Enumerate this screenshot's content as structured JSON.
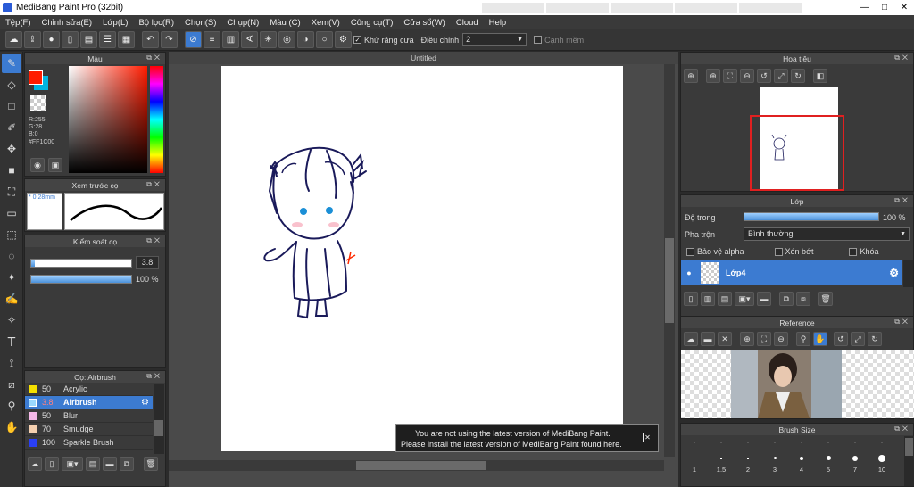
{
  "window": {
    "title": "MediBang Paint Pro (32bit)",
    "tabs": [
      "",
      "",
      "",
      "",
      "",
      ""
    ]
  },
  "menu": [
    "Tệp(F)",
    "Chỉnh sửa(E)",
    "Lớp(L)",
    "Bộ lọc(R)",
    "Chọn(S)",
    "Chụp(N)",
    "Màu (C)",
    "Xem(V)",
    "Công cụ(T)",
    "Cửa sổ(W)",
    "Cloud",
    "Help"
  ],
  "toolbar": {
    "antialias_label": "Khử răng cưa",
    "adjust_label": "Điều chỉnh",
    "adjust_value": "2",
    "canh_mem_label": "Cạnh mềm"
  },
  "color_panel": {
    "title": "Màu",
    "r": "R:255",
    "g": "G:28",
    "b": "B:0",
    "hex": "#FF1C00",
    "fg": "#ff1c00",
    "bg": "#00b4e0"
  },
  "brush_preview": {
    "title": "Xem trước cọ",
    "size": "* 0.28mm"
  },
  "brush_control": {
    "title": "Kiểm soát cọ",
    "size_value": "3.8",
    "opacity_value": "100 %",
    "opacity": 1.0
  },
  "brush_list": {
    "title": "Cọ: Airbrush",
    "items": [
      {
        "num": "50",
        "name": "Acrylic",
        "color": "#f5e000",
        "selected": false
      },
      {
        "num": "3.8",
        "name": "Airbrush",
        "color": "#9ad8ff",
        "selected": true
      },
      {
        "num": "50",
        "name": "Blur",
        "color": "#f5b8e8",
        "selected": false
      },
      {
        "num": "70",
        "name": "Smudge",
        "color": "#f5d0b0",
        "selected": false
      },
      {
        "num": "100",
        "name": "Sparkle Brush",
        "color": "#2a3ff5",
        "selected": false
      }
    ]
  },
  "document": {
    "tab": "Untitled"
  },
  "notice": {
    "line1": "You are not using the latest version of MediBang Paint.",
    "line2": "Please install the latest version of MediBang Paint found here."
  },
  "navigator": {
    "title": "Hoa tiêu"
  },
  "layer_panel": {
    "title": "Lớp",
    "opacity_label": "Độ trong",
    "opacity_value": "100 %",
    "opacity": 1.0,
    "blend_label": "Pha trộn",
    "blend_value": "Bình thường",
    "protect_alpha": "Bảo vệ alpha",
    "clipping": "Xén bớt",
    "lock": "Khóa",
    "layer_name": "Lớp4"
  },
  "reference": {
    "title": "Reference"
  },
  "brush_size": {
    "title": "Brush Size",
    "sizes": [
      "1",
      "1.5",
      "2",
      "3",
      "4",
      "5",
      "7",
      "10"
    ]
  }
}
